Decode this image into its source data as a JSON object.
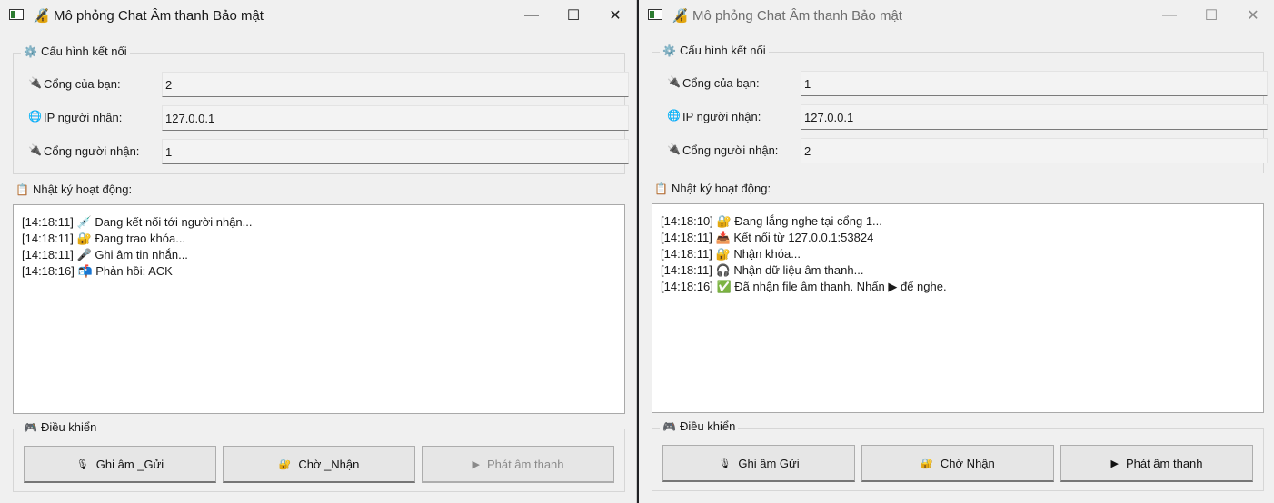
{
  "windows": [
    {
      "title": "Mô phỏng Chat Âm thanh Bảo mật",
      "active": true,
      "config": {
        "legend": "Cấu hình kết nối",
        "your_port_label": "Cổng của bạn:",
        "your_port_value": "2",
        "receiver_ip_label": "IP người nhận:",
        "receiver_ip_value": "127.0.0.1",
        "receiver_port_label": "Cổng người nhận:",
        "receiver_port_value": "1"
      },
      "log": {
        "title": "Nhật ký hoạt động:",
        "lines": [
          {
            "time": "[14:18:11]",
            "icon": "💉",
            "text": "Đang kết nối tới người nhận..."
          },
          {
            "time": "[14:18:11]",
            "icon": "🔐",
            "text": "Đang trao khóa..."
          },
          {
            "time": "[14:18:11]",
            "icon": "🎤",
            "text": "Ghi âm tin nhắn..."
          },
          {
            "time": "[14:18:16]",
            "icon": "📬",
            "text": "Phản hồi: ACK"
          }
        ]
      },
      "controls": {
        "legend": "Điều khiển",
        "record_send": "Ghi âm _Gửi",
        "wait_receive": "Chờ _Nhận",
        "play_audio": "Phát âm thanh",
        "play_enabled": false
      }
    },
    {
      "title": "Mô phỏng Chat Âm thanh Bảo mật",
      "active": false,
      "config": {
        "legend": "Cấu hình kết nối",
        "your_port_label": "Cổng của bạn:",
        "your_port_value": "1",
        "receiver_ip_label": "IP người nhận:",
        "receiver_ip_value": "127.0.0.1",
        "receiver_port_label": "Cổng người nhận:",
        "receiver_port_value": "2"
      },
      "log": {
        "title": "Nhật ký hoạt động:",
        "lines": [
          {
            "time": "[14:18:10]",
            "icon": "🔐",
            "text": "Đang lắng nghe tại cổng 1..."
          },
          {
            "time": "[14:18:11]",
            "icon": "📥",
            "text": "Kết nối từ 127.0.0.1:53824"
          },
          {
            "time": "[14:18:11]",
            "icon": "🔐",
            "text": "Nhận khóa..."
          },
          {
            "time": "[14:18:11]",
            "icon": "🎧",
            "text": "Nhận dữ liệu âm thanh..."
          },
          {
            "time": "[14:18:16]",
            "icon": "✅",
            "text": "Đã nhận file âm thanh. Nhấn ▶ để nghe."
          }
        ]
      },
      "controls": {
        "legend": "Điều khiển",
        "record_send": "Ghi âm  Gửi",
        "wait_receive": "Chờ  Nhận",
        "play_audio": "Phát âm thanh",
        "play_enabled": true
      }
    }
  ],
  "icons": {
    "app": "app-window-icon",
    "title_lock": "🔏",
    "config": "⚙️",
    "port": "🔌",
    "ip": "🌐",
    "log": "📋",
    "controls": "🎮",
    "record": "🎙",
    "wait": "🔐",
    "play": "▶",
    "minimize": "—",
    "maximize": "☐",
    "close": "✕"
  },
  "colors": {
    "window_bg": "#f0f0f0",
    "log_bg": "#ffffff",
    "button_bg": "#e6e6e6",
    "disabled_text": "#8a8a8a"
  }
}
